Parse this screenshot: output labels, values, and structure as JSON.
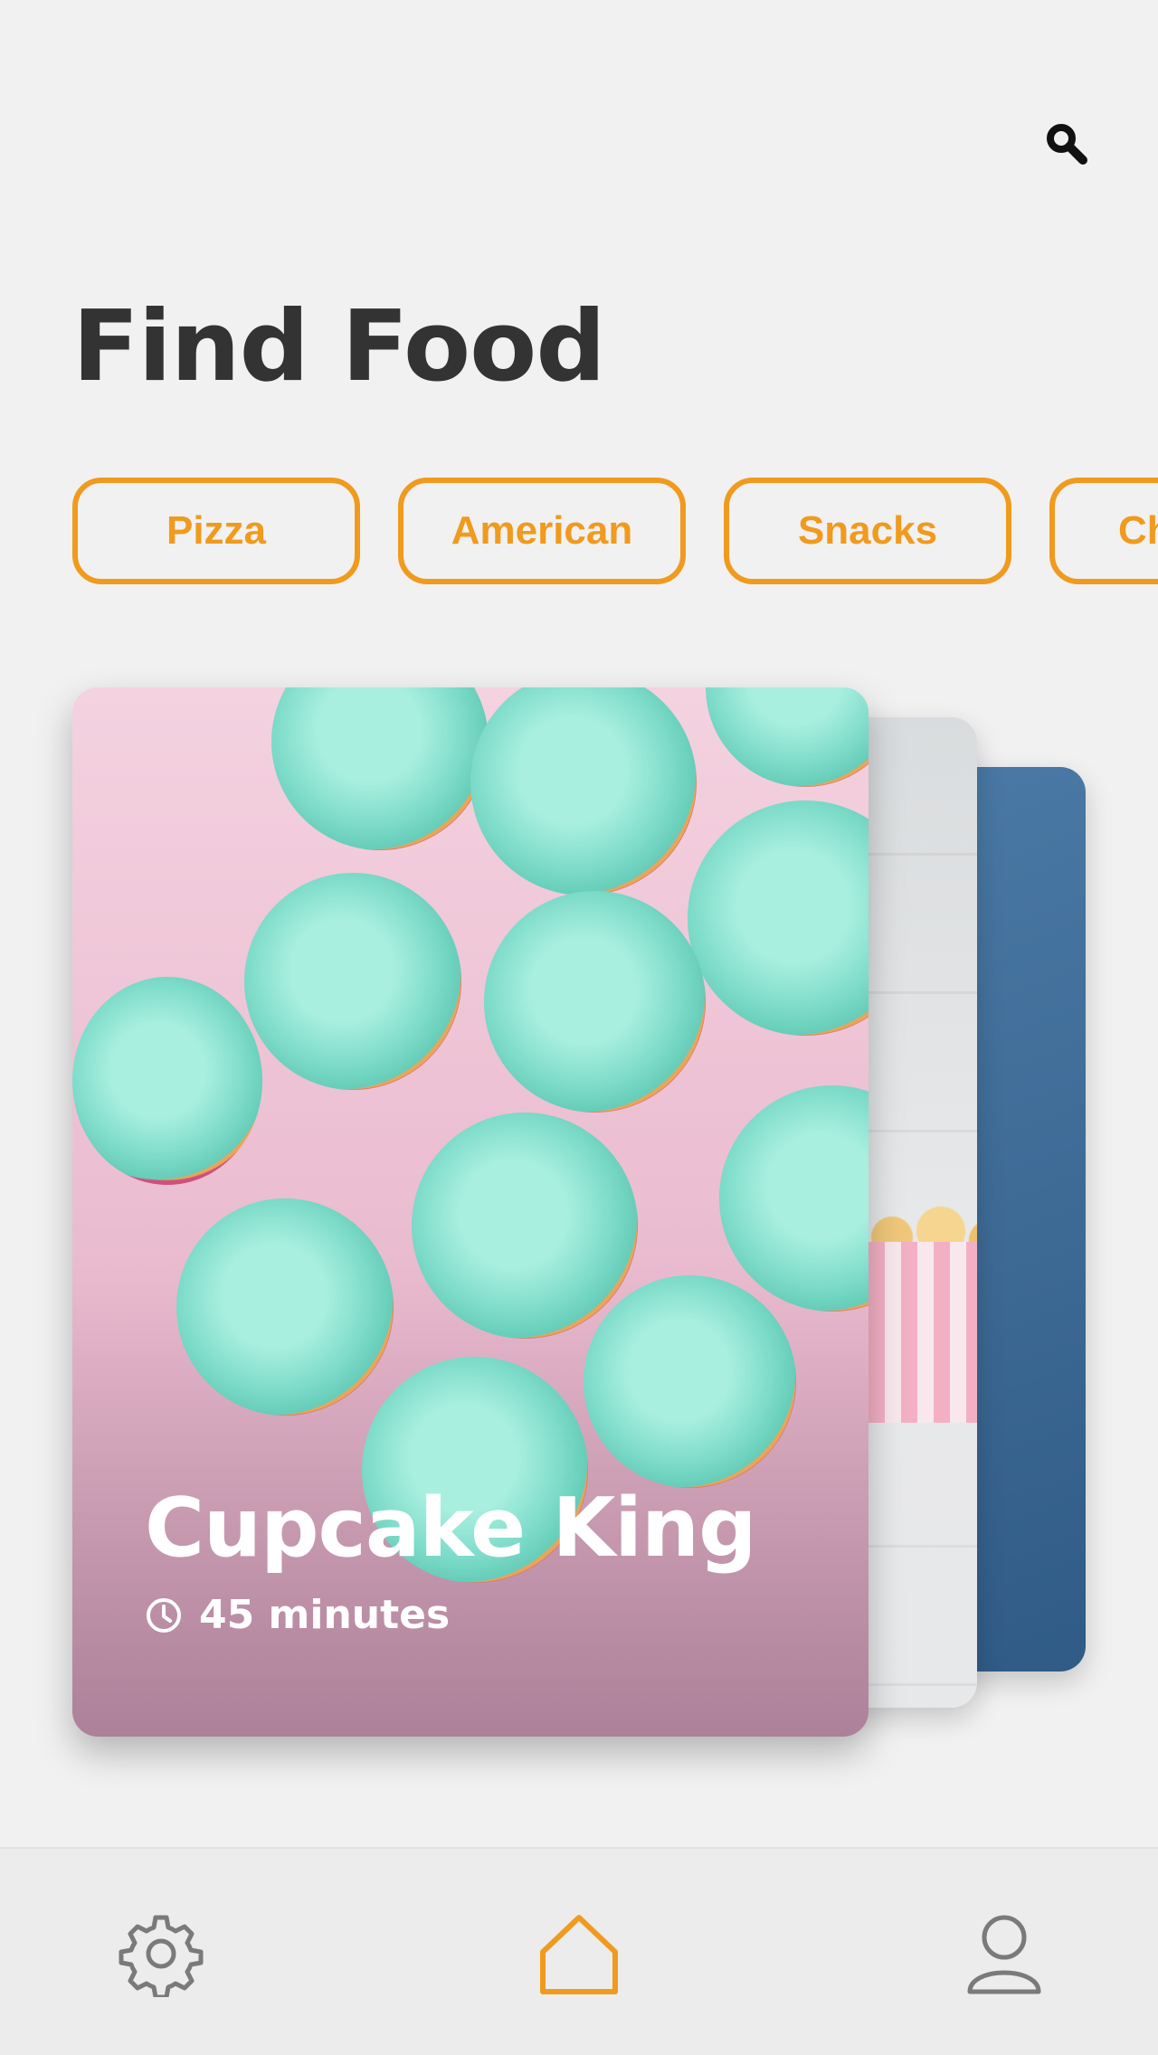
{
  "header": {
    "title": "Find Food",
    "search_icon": "search-icon"
  },
  "categories": [
    {
      "label": "Pizza"
    },
    {
      "label": "American"
    },
    {
      "label": "Snacks"
    },
    {
      "label": "Ch"
    }
  ],
  "featured_card": {
    "title": "Cupcake King",
    "duration": "45 minutes",
    "time_icon": "clock-icon"
  },
  "bottom_nav": {
    "items": [
      {
        "icon": "gear-icon",
        "active": false
      },
      {
        "icon": "home-icon",
        "active": true
      },
      {
        "icon": "user-icon",
        "active": false
      }
    ]
  },
  "colors": {
    "accent": "#F09A1E",
    "title_text": "#333333",
    "background": "#F1F1F2",
    "nav_inactive": "#7A7A7A"
  }
}
